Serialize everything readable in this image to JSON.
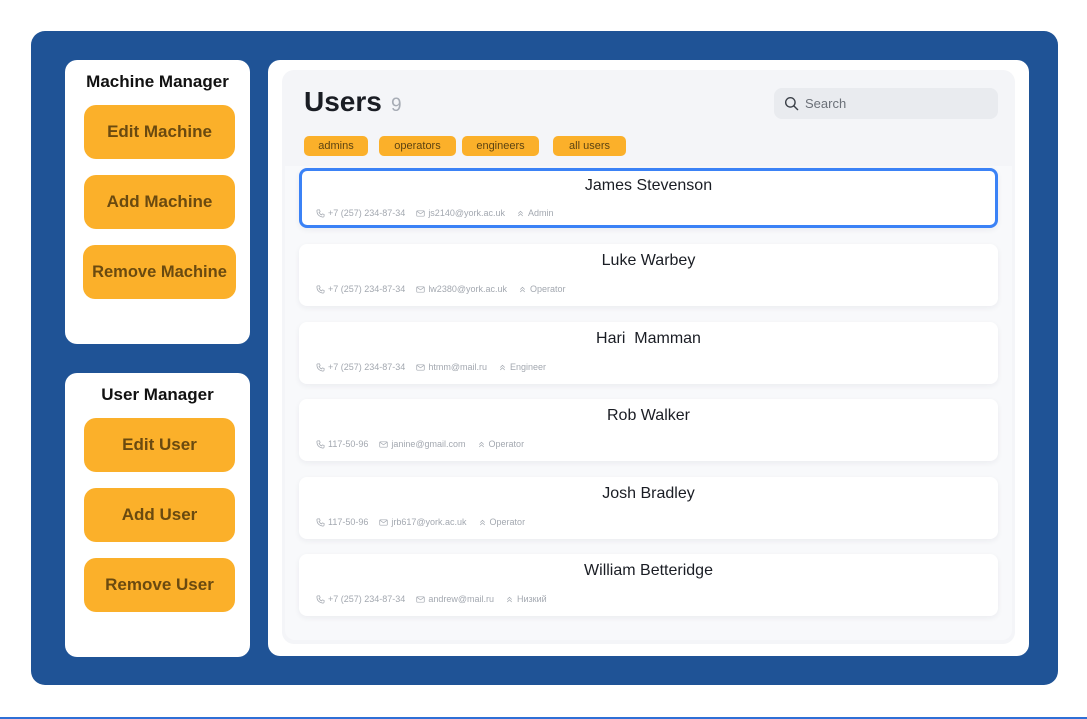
{
  "machine_manager": {
    "title": "Machine Manager",
    "buttons": [
      "Edit Machine",
      "Add Machine",
      "Remove Machine"
    ]
  },
  "user_manager": {
    "title": "User Manager",
    "buttons": [
      "Edit User",
      "Add User",
      "Remove User"
    ]
  },
  "users_panel": {
    "title": "Users",
    "count": "9",
    "search": {
      "placeholder": "Search",
      "value": ""
    },
    "filters": [
      "admins",
      "operators",
      "engineers",
      "all  users"
    ],
    "users": [
      {
        "name": "James Stevenson",
        "phone": "+7 (257) 234-87-34",
        "email": "js2140@york.ac.uk",
        "role": "Admin",
        "selected": true
      },
      {
        "name": "Luke Warbey",
        "phone": "+7 (257) 234-87-34",
        "email": "lw2380@york.ac.uk",
        "role": "Operator"
      },
      {
        "name": "Hari  Mamman",
        "phone": "+7 (257) 234-87-34",
        "email": "htmm@mail.ru",
        "role": "Engineer"
      },
      {
        "name": "Rob Walker",
        "phone": "117-50-96",
        "email": "janine@gmail.com",
        "role": "Operator"
      },
      {
        "name": "Josh Bradley",
        "phone": "117-50-96",
        "email": "jrb617@york.ac.uk",
        "role": "Operator"
      },
      {
        "name": "William Betteridge",
        "phone": "+7 (257) 234-87-34",
        "email": "andrew@mail.ru",
        "role": "Низкий"
      }
    ]
  },
  "colors": {
    "frame": "#1f5396",
    "accent_button": "#fbb02a",
    "selection": "#3b82f6"
  },
  "icons": {
    "search": "search-icon",
    "phone": "phone-icon",
    "email": "mail-icon",
    "role": "chevrons-up-icon"
  }
}
